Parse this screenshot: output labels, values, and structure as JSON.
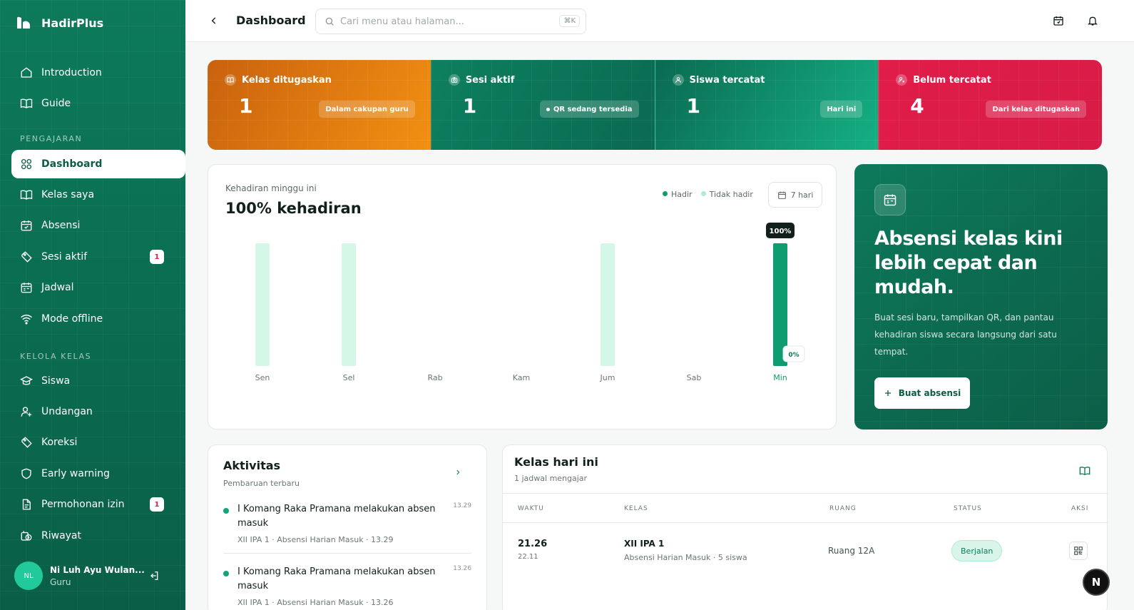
{
  "brand": {
    "name": "HadirPlus"
  },
  "sidebar": {
    "top_items": [
      {
        "label": "Introduction",
        "icon": "home-icon"
      },
      {
        "label": "Guide",
        "icon": "book-open-icon"
      }
    ],
    "section_teaching": "PENGAJARAN",
    "teaching_items": [
      {
        "label": "Dashboard",
        "icon": "grid-icon",
        "active": true
      },
      {
        "label": "Kelas saya",
        "icon": "book-open-icon"
      },
      {
        "label": "Absensi",
        "icon": "calendar-check-icon"
      },
      {
        "label": "Sesi aktif",
        "icon": "tag-icon",
        "badge": "1"
      },
      {
        "label": "Jadwal",
        "icon": "calendar-icon"
      },
      {
        "label": "Mode offline",
        "icon": "wifi-icon"
      }
    ],
    "section_class": "KELOLA KELAS",
    "class_items": [
      {
        "label": "Siswa",
        "icon": "graduation-cap-icon"
      },
      {
        "label": "Undangan",
        "icon": "user-plus-icon"
      },
      {
        "label": "Koreksi",
        "icon": "tag-icon"
      },
      {
        "label": "Early warning",
        "icon": "shield-icon"
      },
      {
        "label": "Permohonan izin",
        "icon": "file-icon",
        "badge": "1"
      },
      {
        "label": "Riwayat",
        "icon": "history-icon"
      }
    ],
    "user": {
      "initials": "NL",
      "name": "Ni Luh Ayu Wulan...",
      "role": "Guru"
    }
  },
  "topbar": {
    "title": "Dashboard",
    "search_placeholder": "Cari menu atau halaman...",
    "shortcut": "⌘K"
  },
  "stats": [
    {
      "label": "Kelas ditugaskan",
      "value": "1",
      "pill": "Dalam cakupan guru",
      "theme": "orange"
    },
    {
      "label": "Sesi aktif",
      "value": "1",
      "pill": "QR sedang tersedia",
      "theme": "green1",
      "dot": true
    },
    {
      "label": "Siswa tercatat",
      "value": "1",
      "pill": "Hari ini",
      "theme": "green2"
    },
    {
      "label": "Belum tercatat",
      "value": "4",
      "pill": "Dari kelas ditugaskan",
      "theme": "red"
    }
  ],
  "attendance": {
    "subtitle": "Kehadiran minggu ini",
    "headline": "100% kehadiran",
    "legend_present": "Hadir",
    "legend_absent": "Tidak hadir",
    "range": "7 hari"
  },
  "chart_data": {
    "type": "bar",
    "categories": [
      "Sen",
      "Sel",
      "Rab",
      "Kam",
      "Jum",
      "Sab",
      "Min"
    ],
    "series": [
      {
        "name": "Hadir",
        "values": [
          0,
          0,
          0,
          0,
          0,
          0,
          100
        ]
      },
      {
        "name": "Tidak hadir",
        "values": [
          0,
          0,
          0,
          0,
          0,
          0,
          0
        ]
      }
    ],
    "scheduled_days": [
      true,
      true,
      false,
      false,
      true,
      false,
      true
    ],
    "highlight_index": 6,
    "tooltip_top": "100%",
    "tooltip_bottom": "0%",
    "colors": {
      "present": "#0f9c70",
      "track": "#d5f7e8"
    },
    "ylim": [
      0,
      100
    ]
  },
  "hero": {
    "title": "Absensi kelas kini lebih cepat dan mudah.",
    "description": "Buat sesi baru, tampilkan QR, dan pantau kehadiran siswa secara langsung dari satu tempat.",
    "button": "Buat absensi"
  },
  "activity": {
    "title": "Aktivitas",
    "subtitle": "Pembaruan terbaru",
    "items": [
      {
        "text": "I Komang Raka Pramana melakukan absen masuk",
        "time": "13.29",
        "meta": "XII IPA 1 · Absensi Harian Masuk · 13.29"
      },
      {
        "text": "I Komang Raka Pramana melakukan absen masuk",
        "time": "13.26",
        "meta": "XII IPA 1 · Absensi Harian Masuk · 13.26"
      }
    ]
  },
  "today": {
    "title": "Kelas hari ini",
    "subtitle": "1 jadwal mengajar",
    "columns": [
      "WAKTU",
      "KELAS",
      "RUANG",
      "STATUS",
      "AKSI"
    ],
    "rows": [
      {
        "time": "21.26",
        "time_sub": "22.11",
        "class": "XII IPA 1",
        "class_sub": "Absensi Harian Masuk · 5 siswa",
        "room": "Ruang 12A",
        "status": "Berjalan"
      }
    ]
  },
  "fab": "N"
}
